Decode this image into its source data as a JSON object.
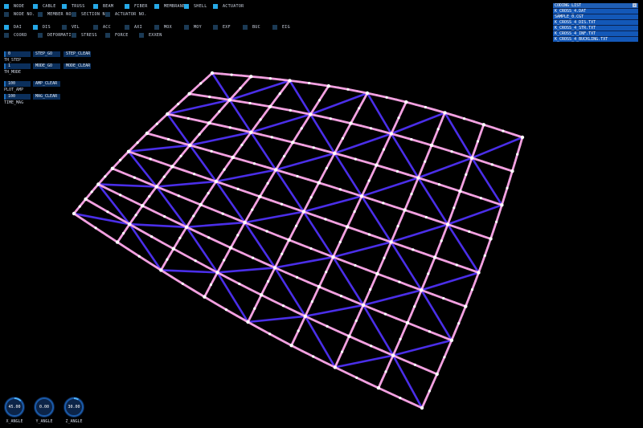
{
  "toggles_row1": [
    {
      "label": "NODE",
      "on": true
    },
    {
      "label": "CABLE",
      "on": true
    },
    {
      "label": "TRUSS",
      "on": true
    },
    {
      "label": "BEAM",
      "on": true
    },
    {
      "label": "FIBER",
      "on": true
    },
    {
      "label": "MEMBRANE",
      "on": true
    },
    {
      "label": "SHELL",
      "on": true
    },
    {
      "label": "ACTUATOR",
      "on": true
    }
  ],
  "toggles_row2": [
    {
      "label": "NODE NO.",
      "on": false
    },
    {
      "label": "MEMBER NO.",
      "on": false
    },
    {
      "label": "SECTION NO.",
      "on": false
    },
    {
      "label": "ACTUATOR NO.",
      "on": false
    }
  ],
  "toggles_row3": [
    {
      "label": "DAI",
      "on": true
    },
    {
      "label": "DIS",
      "on": true
    },
    {
      "label": "VEL",
      "on": false
    },
    {
      "label": "ACC",
      "on": false
    },
    {
      "label": "AXI",
      "on": false
    },
    {
      "label": "MOX",
      "on": false
    },
    {
      "label": "MOY",
      "on": false
    },
    {
      "label": "EXF",
      "on": false
    },
    {
      "label": "BUC",
      "on": false
    },
    {
      "label": "EIG",
      "on": false
    }
  ],
  "toggles_row4": [
    {
      "label": "COORD",
      "on": false
    },
    {
      "label": "DEFORMATION",
      "on": false
    },
    {
      "label": "STRESS",
      "on": false
    },
    {
      "label": "FORCE",
      "on": false
    },
    {
      "label": "EXXEN",
      "on": false
    }
  ],
  "controls": {
    "th_step": {
      "value": "0",
      "label": "TH_STEP",
      "btn1": "STEP_GO",
      "btn2": "STEP_CLEAR"
    },
    "th_mode": {
      "value": "1",
      "label": "TH_MODE",
      "btn1": "MODE_GO",
      "btn2": "MODE_CLEAR"
    },
    "plot_amp": {
      "value": "100",
      "label": "PLOT_AMP",
      "btn1": "AMP_CLEAR"
    },
    "time_mag": {
      "value": "100",
      "label": "TIME_MAG",
      "btn1": "MAG_CLEAR"
    }
  },
  "file_list": {
    "title": "CODING LIST",
    "items": [
      "K_CROSS_4.DAT",
      "SAMPLE_0.CGT",
      "K_CROSS_4_DIS.TXT",
      "K_CROSS_4_STR.TXT",
      "K_CROSS_4_INF.TXT",
      "K_CROSS_4_BUCKLING.TXT"
    ]
  },
  "knobs": [
    {
      "value": "45.00",
      "label": "X_ANGLE",
      "fraction": 0.125
    },
    {
      "value": "0.00",
      "label": "Y_ANGLE",
      "fraction": 0.0
    },
    {
      "value": "30.00",
      "label": "Z_ANGLE",
      "fraction": 0.083
    }
  ],
  "colors": {
    "accent": "#25a8e6",
    "chord": "#f2a0e0",
    "diagonal": "#4a2ee8",
    "node": "#ffffff",
    "panel": "#0b2f5c"
  }
}
